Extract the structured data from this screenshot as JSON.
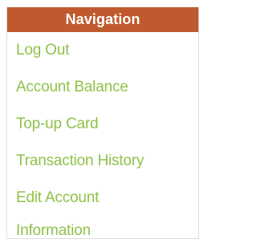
{
  "navigation": {
    "title": "Navigation",
    "items": [
      {
        "label": "Log Out"
      },
      {
        "label": "Account Balance"
      },
      {
        "label": "Top-up Card"
      },
      {
        "label": "Transaction History"
      },
      {
        "label": "Edit Account Information"
      }
    ]
  },
  "colors": {
    "header_background": "#c05a2e",
    "header_text": "#ffffff",
    "link_text": "#8fc24a",
    "border": "#dcdcdc"
  }
}
